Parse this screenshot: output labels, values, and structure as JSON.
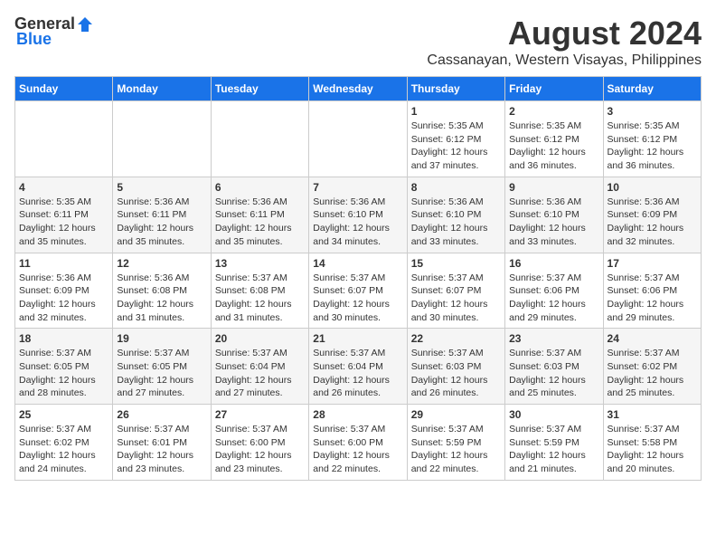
{
  "logo": {
    "general": "General",
    "blue": "Blue"
  },
  "title": {
    "month_year": "August 2024",
    "location": "Cassanayan, Western Visayas, Philippines"
  },
  "days_of_week": [
    "Sunday",
    "Monday",
    "Tuesday",
    "Wednesday",
    "Thursday",
    "Friday",
    "Saturday"
  ],
  "weeks": [
    [
      {
        "day": "",
        "info": ""
      },
      {
        "day": "",
        "info": ""
      },
      {
        "day": "",
        "info": ""
      },
      {
        "day": "",
        "info": ""
      },
      {
        "day": "1",
        "info": "Sunrise: 5:35 AM\nSunset: 6:12 PM\nDaylight: 12 hours\nand 37 minutes."
      },
      {
        "day": "2",
        "info": "Sunrise: 5:35 AM\nSunset: 6:12 PM\nDaylight: 12 hours\nand 36 minutes."
      },
      {
        "day": "3",
        "info": "Sunrise: 5:35 AM\nSunset: 6:12 PM\nDaylight: 12 hours\nand 36 minutes."
      }
    ],
    [
      {
        "day": "4",
        "info": "Sunrise: 5:35 AM\nSunset: 6:11 PM\nDaylight: 12 hours\nand 35 minutes."
      },
      {
        "day": "5",
        "info": "Sunrise: 5:36 AM\nSunset: 6:11 PM\nDaylight: 12 hours\nand 35 minutes."
      },
      {
        "day": "6",
        "info": "Sunrise: 5:36 AM\nSunset: 6:11 PM\nDaylight: 12 hours\nand 35 minutes."
      },
      {
        "day": "7",
        "info": "Sunrise: 5:36 AM\nSunset: 6:10 PM\nDaylight: 12 hours\nand 34 minutes."
      },
      {
        "day": "8",
        "info": "Sunrise: 5:36 AM\nSunset: 6:10 PM\nDaylight: 12 hours\nand 33 minutes."
      },
      {
        "day": "9",
        "info": "Sunrise: 5:36 AM\nSunset: 6:10 PM\nDaylight: 12 hours\nand 33 minutes."
      },
      {
        "day": "10",
        "info": "Sunrise: 5:36 AM\nSunset: 6:09 PM\nDaylight: 12 hours\nand 32 minutes."
      }
    ],
    [
      {
        "day": "11",
        "info": "Sunrise: 5:36 AM\nSunset: 6:09 PM\nDaylight: 12 hours\nand 32 minutes."
      },
      {
        "day": "12",
        "info": "Sunrise: 5:36 AM\nSunset: 6:08 PM\nDaylight: 12 hours\nand 31 minutes."
      },
      {
        "day": "13",
        "info": "Sunrise: 5:37 AM\nSunset: 6:08 PM\nDaylight: 12 hours\nand 31 minutes."
      },
      {
        "day": "14",
        "info": "Sunrise: 5:37 AM\nSunset: 6:07 PM\nDaylight: 12 hours\nand 30 minutes."
      },
      {
        "day": "15",
        "info": "Sunrise: 5:37 AM\nSunset: 6:07 PM\nDaylight: 12 hours\nand 30 minutes."
      },
      {
        "day": "16",
        "info": "Sunrise: 5:37 AM\nSunset: 6:06 PM\nDaylight: 12 hours\nand 29 minutes."
      },
      {
        "day": "17",
        "info": "Sunrise: 5:37 AM\nSunset: 6:06 PM\nDaylight: 12 hours\nand 29 minutes."
      }
    ],
    [
      {
        "day": "18",
        "info": "Sunrise: 5:37 AM\nSunset: 6:05 PM\nDaylight: 12 hours\nand 28 minutes."
      },
      {
        "day": "19",
        "info": "Sunrise: 5:37 AM\nSunset: 6:05 PM\nDaylight: 12 hours\nand 27 minutes."
      },
      {
        "day": "20",
        "info": "Sunrise: 5:37 AM\nSunset: 6:04 PM\nDaylight: 12 hours\nand 27 minutes."
      },
      {
        "day": "21",
        "info": "Sunrise: 5:37 AM\nSunset: 6:04 PM\nDaylight: 12 hours\nand 26 minutes."
      },
      {
        "day": "22",
        "info": "Sunrise: 5:37 AM\nSunset: 6:03 PM\nDaylight: 12 hours\nand 26 minutes."
      },
      {
        "day": "23",
        "info": "Sunrise: 5:37 AM\nSunset: 6:03 PM\nDaylight: 12 hours\nand 25 minutes."
      },
      {
        "day": "24",
        "info": "Sunrise: 5:37 AM\nSunset: 6:02 PM\nDaylight: 12 hours\nand 25 minutes."
      }
    ],
    [
      {
        "day": "25",
        "info": "Sunrise: 5:37 AM\nSunset: 6:02 PM\nDaylight: 12 hours\nand 24 minutes."
      },
      {
        "day": "26",
        "info": "Sunrise: 5:37 AM\nSunset: 6:01 PM\nDaylight: 12 hours\nand 23 minutes."
      },
      {
        "day": "27",
        "info": "Sunrise: 5:37 AM\nSunset: 6:00 PM\nDaylight: 12 hours\nand 23 minutes."
      },
      {
        "day": "28",
        "info": "Sunrise: 5:37 AM\nSunset: 6:00 PM\nDaylight: 12 hours\nand 22 minutes."
      },
      {
        "day": "29",
        "info": "Sunrise: 5:37 AM\nSunset: 5:59 PM\nDaylight: 12 hours\nand 22 minutes."
      },
      {
        "day": "30",
        "info": "Sunrise: 5:37 AM\nSunset: 5:59 PM\nDaylight: 12 hours\nand 21 minutes."
      },
      {
        "day": "31",
        "info": "Sunrise: 5:37 AM\nSunset: 5:58 PM\nDaylight: 12 hours\nand 20 minutes."
      }
    ]
  ]
}
